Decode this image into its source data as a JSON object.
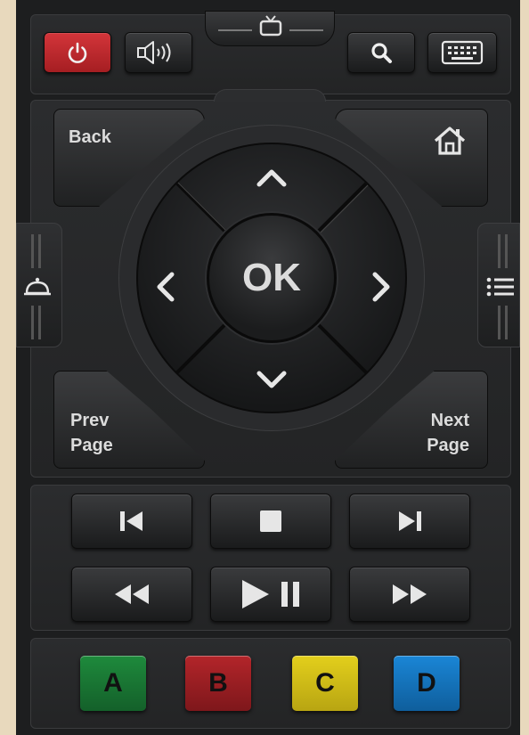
{
  "top_bar": {
    "power_icon": "power-icon",
    "volume_icon": "volume-icon",
    "tv_icon": "tv-icon",
    "search_icon": "search-icon",
    "keyboard_icon": "keyboard-icon",
    "power_color": "#c0262a"
  },
  "nav": {
    "back_label": "Back",
    "home_icon": "home-icon",
    "ok_label": "OK",
    "prev_page_line1": "Prev",
    "prev_page_line2": "Page",
    "next_page_line1": "Next",
    "next_page_line2": "Page",
    "left_tab_icon": "service-bell-icon",
    "right_tab_icon": "list-icon"
  },
  "transport": {
    "row1": [
      "skip-previous-icon",
      "stop-icon",
      "skip-next-icon"
    ],
    "row2": [
      "rewind-icon",
      "play-pause-icon",
      "fast-forward-icon"
    ]
  },
  "colors": {
    "a_label": "A",
    "a_color": "#1e8a3c",
    "b_label": "B",
    "b_color": "#b3252a",
    "c_label": "C",
    "c_color": "#e3cf1c",
    "d_label": "D",
    "d_color": "#1a86d6"
  }
}
